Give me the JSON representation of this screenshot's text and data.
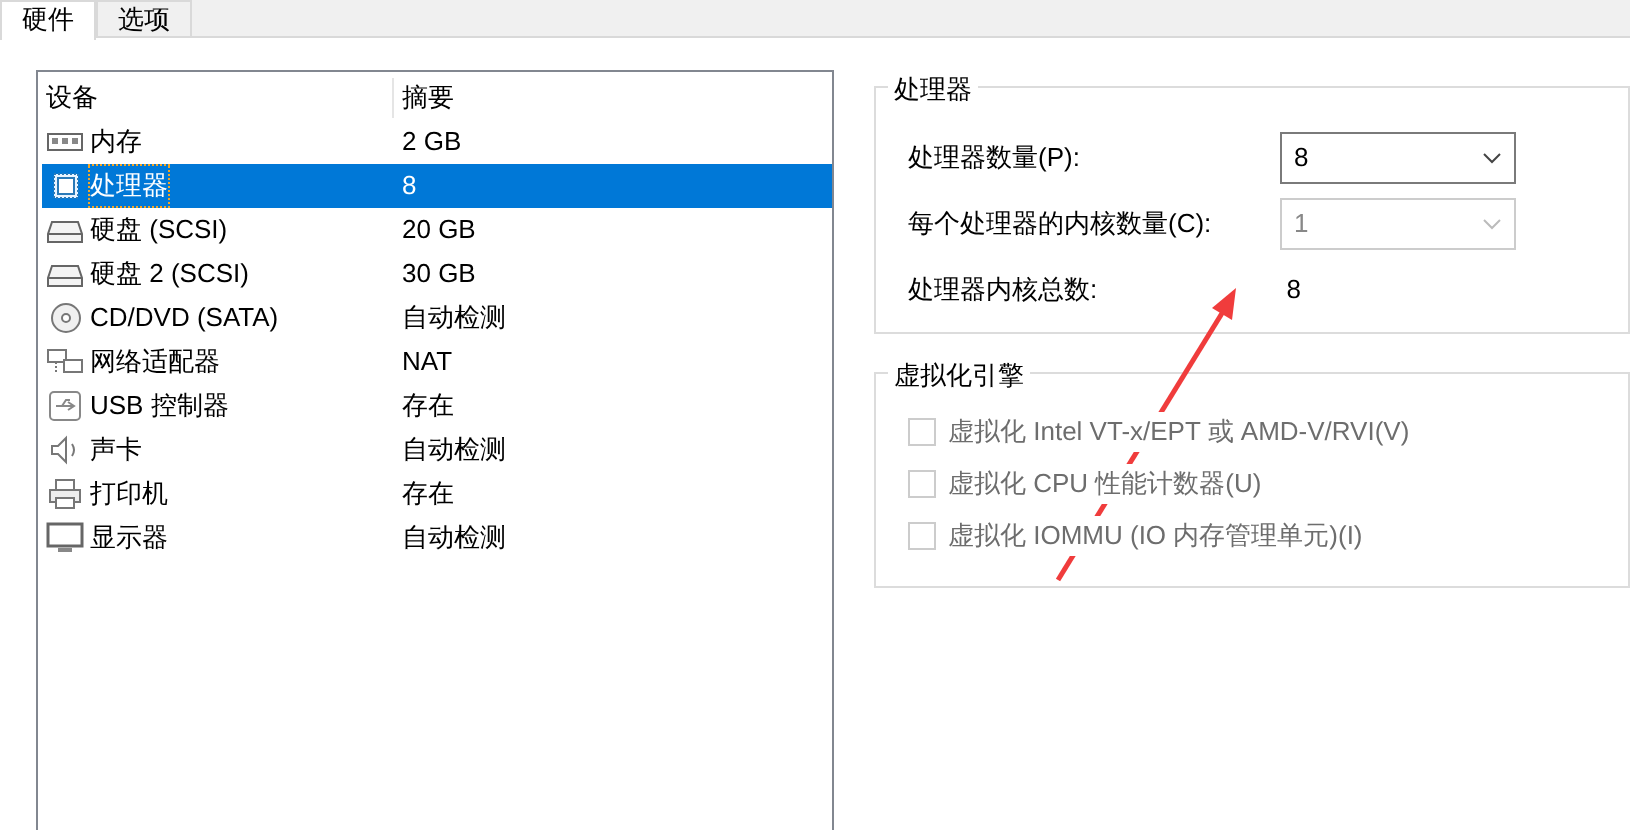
{
  "tabs": [
    {
      "label": "硬件",
      "selected": true
    },
    {
      "label": "选项",
      "selected": false
    }
  ],
  "device_list": {
    "columns": [
      "设备",
      "摘要"
    ],
    "rows": [
      {
        "kind": "memory",
        "device": "内存",
        "summary": "2 GB",
        "selected": false
      },
      {
        "kind": "cpu",
        "device": "处理器",
        "summary": "8",
        "selected": true
      },
      {
        "kind": "disk",
        "device": "硬盘 (SCSI)",
        "summary": "20 GB",
        "selected": false
      },
      {
        "kind": "disk",
        "device": "硬盘 2 (SCSI)",
        "summary": "30 GB",
        "selected": false
      },
      {
        "kind": "cd",
        "device": "CD/DVD (SATA)",
        "summary": "自动检测",
        "selected": false
      },
      {
        "kind": "network",
        "device": "网络适配器",
        "summary": "NAT",
        "selected": false
      },
      {
        "kind": "usb",
        "device": "USB 控制器",
        "summary": "存在",
        "selected": false
      },
      {
        "kind": "sound",
        "device": "声卡",
        "summary": "自动检测",
        "selected": false
      },
      {
        "kind": "printer",
        "device": "打印机",
        "summary": "存在",
        "selected": false
      },
      {
        "kind": "display",
        "device": "显示器",
        "summary": "自动检测",
        "selected": false
      }
    ]
  },
  "processor_group": {
    "title": "处理器",
    "fields": [
      {
        "kind": "select",
        "label": "处理器数量(P):",
        "value": "8",
        "disabled": false
      },
      {
        "kind": "select",
        "label": "每个处理器的内核数量(C):",
        "value": "1",
        "disabled": true
      },
      {
        "kind": "text",
        "label": "处理器内核总数:",
        "value": "8"
      }
    ]
  },
  "virtualization_group": {
    "title": "虚拟化引擎",
    "options": [
      {
        "label": "虚拟化 Intel VT-x/EPT 或 AMD-V/RVI(V)",
        "checked": false,
        "disabled": true
      },
      {
        "label": "虚拟化 CPU 性能计数器(U)",
        "checked": false,
        "disabled": true
      },
      {
        "label": "虚拟化 IOMMU (IO 内存管理单元)(I)",
        "checked": false,
        "disabled": true
      }
    ]
  }
}
